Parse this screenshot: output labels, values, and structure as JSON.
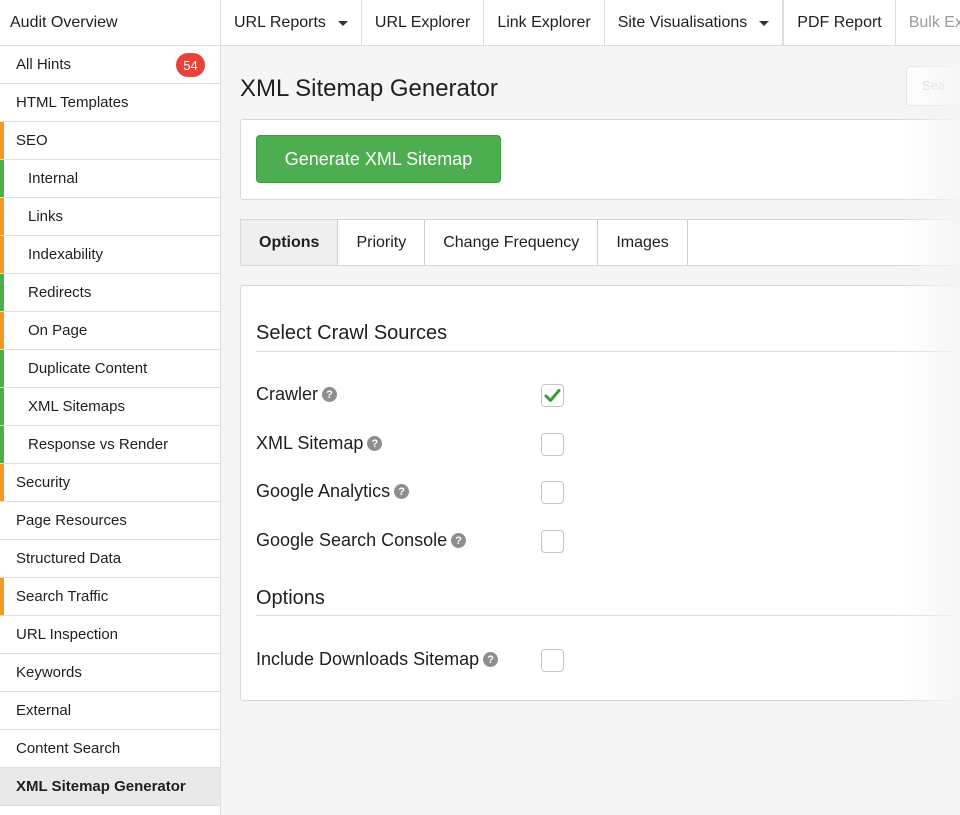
{
  "app": {
    "title": "Audit Overview"
  },
  "nav": {
    "url_reports": "URL Reports",
    "url_explorer": "URL Explorer",
    "link_explorer": "Link Explorer",
    "site_visualisations": "Site Visualisations",
    "pdf_report": "PDF Report",
    "bulk_export": "Bulk Expo"
  },
  "sidebar": {
    "hints_count": "54",
    "items": [
      {
        "label": "All Hints",
        "bar": ""
      },
      {
        "label": "HTML Templates",
        "bar": ""
      },
      {
        "label": "SEO",
        "bar": "#f39a24"
      },
      {
        "label": "Internal",
        "bar": "#4cae4f"
      },
      {
        "label": "Links",
        "bar": "#f39a24"
      },
      {
        "label": "Indexability",
        "bar": "#f39a24"
      },
      {
        "label": "Redirects",
        "bar": "#4cae4f"
      },
      {
        "label": "On Page",
        "bar": "#f39a24"
      },
      {
        "label": "Duplicate Content",
        "bar": "#4cae4f"
      },
      {
        "label": "XML Sitemaps",
        "bar": "#4cae4f"
      },
      {
        "label": "Response vs Render",
        "bar": "#4cae4f"
      },
      {
        "label": "Security",
        "bar": "#f39a24"
      },
      {
        "label": "Page Resources",
        "bar": ""
      },
      {
        "label": "Structured Data",
        "bar": ""
      },
      {
        "label": "Search Traffic",
        "bar": "#f39a24"
      },
      {
        "label": "URL Inspection",
        "bar": ""
      },
      {
        "label": "Keywords",
        "bar": ""
      },
      {
        "label": "External",
        "bar": ""
      },
      {
        "label": "Content Search",
        "bar": ""
      },
      {
        "label": "XML Sitemap Generator",
        "bar": ""
      }
    ]
  },
  "main": {
    "title": "XML Sitemap Generator",
    "search_placeholder": "Sea",
    "generate_button": "Generate XML Sitemap",
    "tabs": [
      "Options",
      "Priority",
      "Change Frequency",
      "Images"
    ],
    "sources_heading": "Select Crawl Sources",
    "sources": [
      {
        "label": "Crawler",
        "checked": true
      },
      {
        "label": "XML Sitemap",
        "checked": false
      },
      {
        "label": "Google Analytics",
        "checked": false
      },
      {
        "label": "Google Search Console",
        "checked": false
      }
    ],
    "options_heading": "Options",
    "options": [
      {
        "label": "Include Downloads Sitemap",
        "checked": false
      }
    ],
    "help_glyph": "?"
  },
  "colors": {
    "accent_green": "#4cae4f",
    "accent_orange": "#f39a24",
    "badge_red": "#e8433a"
  }
}
